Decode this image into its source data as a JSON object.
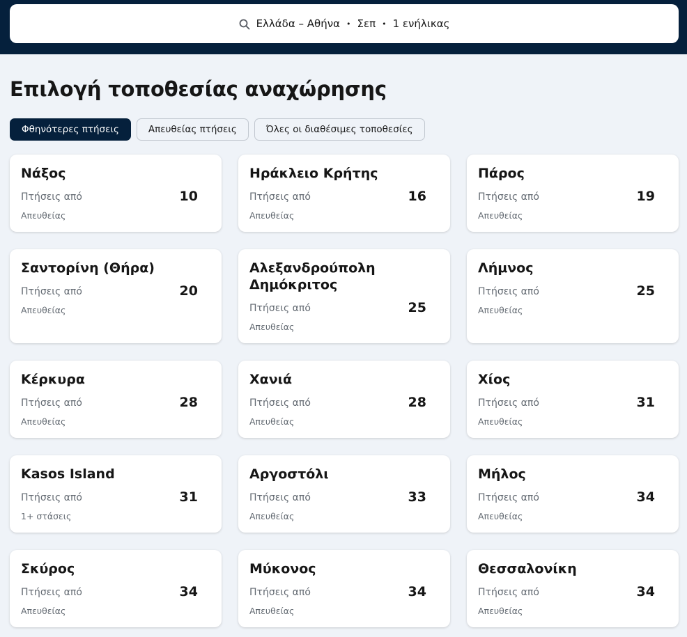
{
  "search": {
    "destination": "Ελλάδα – Αθήνα",
    "month": "Σεπ",
    "travellers": "1 ενήλικας",
    "separator": "•"
  },
  "page_title": "Επιλογή τοποθεσίας αναχώρησης",
  "tabs": [
    {
      "label": "Φθηνότερες πτήσεις",
      "active": true
    },
    {
      "label": "Απευθείας πτήσεις",
      "active": false
    },
    {
      "label": "Όλες οι διαθέσιμες τοποθεσίες",
      "active": false
    }
  ],
  "cards": [
    {
      "name": "Νάξος",
      "from": "Πτήσεις από",
      "price": "10",
      "stops": "Απευθείας"
    },
    {
      "name": "Ηράκλειο Κρήτης",
      "from": "Πτήσεις από",
      "price": "16",
      "stops": "Απευθείας"
    },
    {
      "name": "Πάρος",
      "from": "Πτήσεις από",
      "price": "19",
      "stops": "Απευθείας"
    },
    {
      "name": "Σαντορίνη (Θήρα)",
      "from": "Πτήσεις από",
      "price": "20",
      "stops": "Απευθείας"
    },
    {
      "name": "Αλεξανδρούπολη Δημόκριτος",
      "from": "Πτήσεις από",
      "price": "25",
      "stops": "Απευθείας"
    },
    {
      "name": "Λήμνος",
      "from": "Πτήσεις από",
      "price": "25",
      "stops": "Απευθείας"
    },
    {
      "name": "Κέρκυρα",
      "from": "Πτήσεις από",
      "price": "28",
      "stops": "Απευθείας"
    },
    {
      "name": "Χανιά",
      "from": "Πτήσεις από",
      "price": "28",
      "stops": "Απευθείας"
    },
    {
      "name": "Χίος",
      "from": "Πτήσεις από",
      "price": "31",
      "stops": "Απευθείας"
    },
    {
      "name": "Kasos Island",
      "from": "Πτήσεις από",
      "price": "31",
      "stops": "1+ στάσεις"
    },
    {
      "name": "Αργοστόλι",
      "from": "Πτήσεις από",
      "price": "33",
      "stops": "Απευθείας"
    },
    {
      "name": "Μήλος",
      "from": "Πτήσεις από",
      "price": "34",
      "stops": "Απευθείας"
    },
    {
      "name": "Σκύρος",
      "from": "Πτήσεις από",
      "price": "34",
      "stops": "Απευθείας"
    },
    {
      "name": "Μύκονος",
      "from": "Πτήσεις από",
      "price": "34",
      "stops": "Απευθείας"
    },
    {
      "name": "Θεσσαλονίκη",
      "from": "Πτήσεις από",
      "price": "34",
      "stops": "Απευθείας"
    }
  ]
}
